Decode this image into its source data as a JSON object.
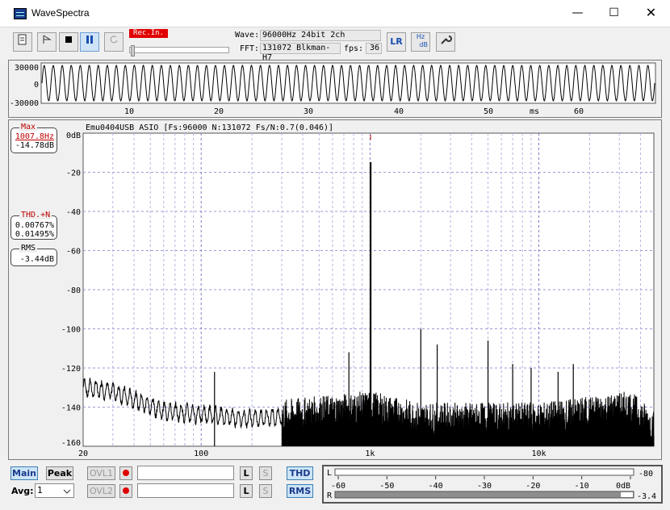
{
  "window": {
    "title": "WaveSpectra",
    "min_glyph": "—",
    "max_glyph": "☐",
    "close_glyph": "✕"
  },
  "toolbar": {
    "rec_label": "Rec.In.",
    "wave_label": "Wave:",
    "wave_value": "96000Hz 24bit 2ch",
    "fft_label": "FFT:",
    "fft_value": "131072 Blkman-H7",
    "fps_label": "fps:",
    "fps_value": "36",
    "lr_label": "LR",
    "hz_label": "Hz",
    "db_label": "dB"
  },
  "wave": {
    "y_ticks": [
      "30000",
      "0",
      "-30000"
    ],
    "x_ticks": [
      "10",
      "20",
      "30",
      "40",
      "50",
      "60"
    ],
    "x_unit": "ms"
  },
  "spectrum": {
    "header": "Emu0404USB ASIO  [Fs:96000 N:131072 Fs/N:0.7(0.046)]",
    "y_ticks": [
      "0dB",
      "-20",
      "-40",
      "-60",
      "-80",
      "-100",
      "-120",
      "-140",
      "-160"
    ],
    "x_ticks": [
      "20",
      "100",
      "1k",
      "10k"
    ],
    "max": {
      "title": "Max",
      "freq": "1007.8Hz",
      "level": "-14.78dB"
    },
    "thd": {
      "title": "THD.+N",
      "v1": "0.00767%",
      "v2": "0.01495%"
    },
    "rms": {
      "title": "RMS",
      "value": "-3.44dB"
    }
  },
  "chart_data": {
    "type": "line",
    "title": "",
    "xlabel": "",
    "ylabel": "",
    "xscale": "log",
    "xlim": [
      20,
      48000
    ],
    "ylim": [
      -160,
      0
    ],
    "grid": true,
    "peaks": [
      {
        "x": 1007.8,
        "y": -14.78
      },
      {
        "x": 2000,
        "y": -100
      },
      {
        "x": 2500,
        "y": -108
      },
      {
        "x": 5000,
        "y": -106
      },
      {
        "x": 7000,
        "y": -118
      },
      {
        "x": 9000,
        "y": -120
      },
      {
        "x": 13000,
        "y": -122
      },
      {
        "x": 16000,
        "y": -118
      },
      {
        "x": 750,
        "y": -112
      },
      {
        "x": 120,
        "y": -122
      }
    ],
    "noise_floor": [
      {
        "x": 20,
        "y": -130
      },
      {
        "x": 30,
        "y": -132
      },
      {
        "x": 60,
        "y": -142
      },
      {
        "x": 200,
        "y": -146
      },
      {
        "x": 1000,
        "y": -140
      },
      {
        "x": 2000,
        "y": -146
      },
      {
        "x": 10000,
        "y": -146
      },
      {
        "x": 35000,
        "y": -140
      },
      {
        "x": 48000,
        "y": -150
      }
    ]
  },
  "bottom": {
    "main_label": "Main",
    "peak_label": "Peak",
    "ovl1_label": "OVL1",
    "ovl2_label": "OVL2",
    "l_label": "L",
    "s_label": "S",
    "thd_label": "THD",
    "rms_label": "RMS",
    "avg_label": "Avg:",
    "avg_value": "1",
    "level_scale": [
      "-60",
      "-50",
      "-40",
      "-30",
      "-20",
      "-10",
      "0dB"
    ],
    "level_l_value": "-80",
    "level_r_value": "-3.4",
    "channel_l": "L",
    "channel_r": "R",
    "level_r_fraction": 0.04
  }
}
